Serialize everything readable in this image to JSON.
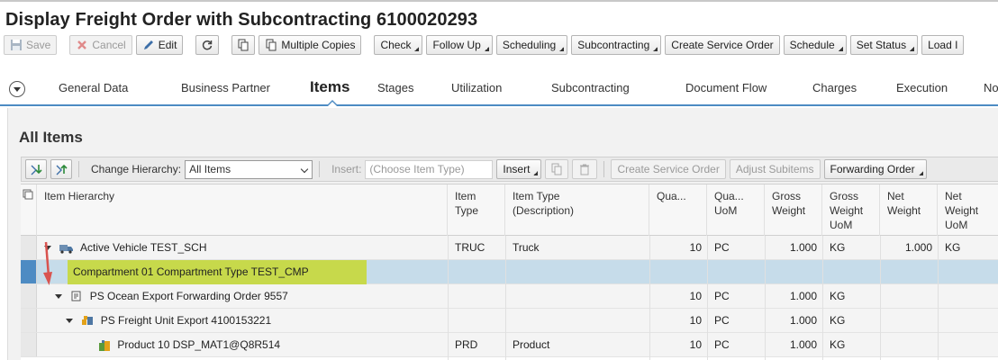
{
  "window": {
    "title": "Display Freight Order with Subcontracting 6100020293"
  },
  "toolbar": {
    "save": "Save",
    "cancel": "Cancel",
    "edit": "Edit",
    "multiple_copies": "Multiple Copies",
    "check": "Check",
    "follow_up": "Follow Up",
    "scheduling": "Scheduling",
    "subcontracting": "Subcontracting",
    "create_service_order": "Create Service Order",
    "schedule": "Schedule",
    "set_status": "Set Status",
    "load": "Load I"
  },
  "tabs": {
    "general_data": "General Data",
    "business_partner": "Business Partner",
    "items": "Items",
    "stages": "Stages",
    "utilization": "Utilization",
    "subcontracting": "Subcontracting",
    "document_flow": "Document Flow",
    "charges": "Charges",
    "execution": "Execution",
    "notes": "No"
  },
  "section": {
    "title": "All Items"
  },
  "items_toolbar": {
    "change_hierarchy_label": "Change Hierarchy:",
    "change_hierarchy_value": "All Items",
    "insert_label": "Insert:",
    "insert_placeholder": "(Choose Item Type)",
    "insert_button": "Insert",
    "create_service_order": "Create Service Order",
    "adjust_subitems": "Adjust Subitems",
    "forwarding_order": "Forwarding Order"
  },
  "columns": {
    "item_hierarchy": "Item Hierarchy",
    "item_type_1": "Item",
    "item_type_2": "Type",
    "item_type_desc_1": "Item Type",
    "item_type_desc_2": "(Description)",
    "quantity": "Qua...",
    "quantity_uom_1": "Qua...",
    "quantity_uom_2": "UoM",
    "gross_weight_1": "Gross",
    "gross_weight_2": "Weight",
    "gross_weight_uom_1": "Gross",
    "gross_weight_uom_2": "Weight",
    "gross_weight_uom_3": "UoM",
    "net_weight_1": "Net",
    "net_weight_2": "Weight",
    "net_weight_uom_1": "Net",
    "net_weight_uom_2": "Weight",
    "net_weight_uom_3": "UoM"
  },
  "rows": [
    {
      "name": "Active Vehicle TEST_SCH",
      "item_type": "TRUC",
      "type_desc": "Truck",
      "qty": "10",
      "qty_uom": "PC",
      "gross": "1.000",
      "gross_uom": "KG",
      "net": "1.000",
      "net_uom": "KG"
    },
    {
      "name": "Compartment 01 Compartment Type TEST_CMP",
      "item_type": "",
      "type_desc": "",
      "qty": "",
      "qty_uom": "",
      "gross": "",
      "gross_uom": "",
      "net": "",
      "net_uom": ""
    },
    {
      "name": "PS Ocean Export Forwarding Order 9557",
      "item_type": "",
      "type_desc": "",
      "qty": "10",
      "qty_uom": "PC",
      "gross": "1.000",
      "gross_uom": "KG",
      "net": "",
      "net_uom": ""
    },
    {
      "name": "PS Freight Unit Export 4100153221",
      "item_type": "",
      "type_desc": "",
      "qty": "10",
      "qty_uom": "PC",
      "gross": "1.000",
      "gross_uom": "KG",
      "net": "",
      "net_uom": ""
    },
    {
      "name": "Product 10 DSP_MAT1@Q8R514",
      "item_type": "PRD",
      "type_desc": "Product",
      "qty": "10",
      "qty_uom": "PC",
      "gross": "1.000",
      "gross_uom": "KG",
      "net": "",
      "net_uom": ""
    }
  ],
  "colors": {
    "accent": "#4d8bc3",
    "selected_row": "#c6dcea",
    "highlight": "#c7d94b",
    "annotation_arrow": "#d9534f"
  }
}
